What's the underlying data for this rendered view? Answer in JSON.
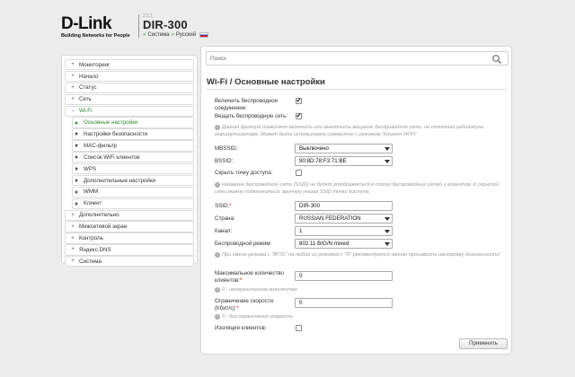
{
  "header": {
    "logo_text": "D-Link",
    "logo_sub": "Building Networks for People",
    "firmware": "2.5.1",
    "model": "DIR-300",
    "crumbs": [
      "Система",
      "Русский"
    ]
  },
  "sidebar": {
    "items": [
      {
        "label": "Мониторинг",
        "level": 0,
        "state": "collapsed"
      },
      {
        "label": "Начало",
        "level": 0,
        "state": "collapsed"
      },
      {
        "label": "Статус",
        "level": 0,
        "state": "collapsed"
      },
      {
        "label": "Сеть",
        "level": 0,
        "state": "collapsed"
      },
      {
        "label": "Wi-Fi",
        "level": 0,
        "state": "expanded"
      },
      {
        "label": "Основные настройки",
        "level": 1,
        "state": "active"
      },
      {
        "label": "Настройки безопасности",
        "level": 1
      },
      {
        "label": "MAC-фильтр",
        "level": 1
      },
      {
        "label": "Список WiFi клиентов",
        "level": 1
      },
      {
        "label": "WPS",
        "level": 1
      },
      {
        "label": "Дополнительные настройки",
        "level": 1
      },
      {
        "label": "WMM",
        "level": 1
      },
      {
        "label": "Клиент",
        "level": 1
      },
      {
        "label": "Дополнительно",
        "level": 0,
        "state": "collapsed"
      },
      {
        "label": "Межсетевой экран",
        "level": 0,
        "state": "collapsed"
      },
      {
        "label": "Контроль",
        "level": 0,
        "state": "collapsed"
      },
      {
        "label": "Яндекс.DNS",
        "level": 0,
        "state": "collapsed"
      },
      {
        "label": "Система",
        "level": 0,
        "state": "collapsed"
      }
    ]
  },
  "search": {
    "placeholder": "Поиск"
  },
  "page": {
    "title_section": "Wi-Fi /",
    "title_page": "Основные настройки"
  },
  "form": {
    "enable_wireless_label": "Включить беспроводное соединение:",
    "enable_wireless_checked": true,
    "broadcast_label": "Вещать беспроводную сеть:",
    "broadcast_checked": true,
    "broadcast_note": "Данная функция позволяет включить или выключить вещание беспроводной сети, не отключая радиоодуль маршрутизатора. Может быть использована совместно с режимом \"Клиент Wi-Fi\"",
    "mbssid_label": "MBSSID:",
    "mbssid_value": "Выключено",
    "bssid_label": "BSSID:",
    "bssid_value": "90:8D:78:F3:71:BE",
    "hide_ap_label": "Скрыть точку доступа:",
    "hide_ap_checked": false,
    "hide_note": "Название беспроводной сети (SSID) не будет отображаться в списке беспроводных сетей у клиентов. К скрытой сети можно подключиться, вручную указав SSID точки доступа",
    "ssid_label": "SSID:",
    "ssid_value": "DIR-300",
    "country_label": "Страна:",
    "country_value": "RUSSIAN FEDERATION",
    "channel_label": "Канал:",
    "channel_value": "1",
    "mode_label": "Беспроводной режим:",
    "mode_value": "802.11 B/G/N mixed",
    "mode_note": "При смене режима с \"B/\"/G\" на любой из режимов с \"N\" рекомендуется заново произвести настройку безопасности!",
    "max_clients_label": "Максимальное количество клиентов:",
    "max_clients_value": "0",
    "max_clients_note": "0 - неограниченное количество",
    "speed_limit_label": "Ограничение скорости (Кбит/с):",
    "speed_limit_value": "0",
    "speed_limit_note": "0 - без ограничения скорости",
    "isolation_label": "Изоляция клиентов:",
    "isolation_checked": false,
    "apply_label": "Применить"
  },
  "colors": {
    "accent_green": "#2e8b2e",
    "required_red": "#cc0000"
  }
}
